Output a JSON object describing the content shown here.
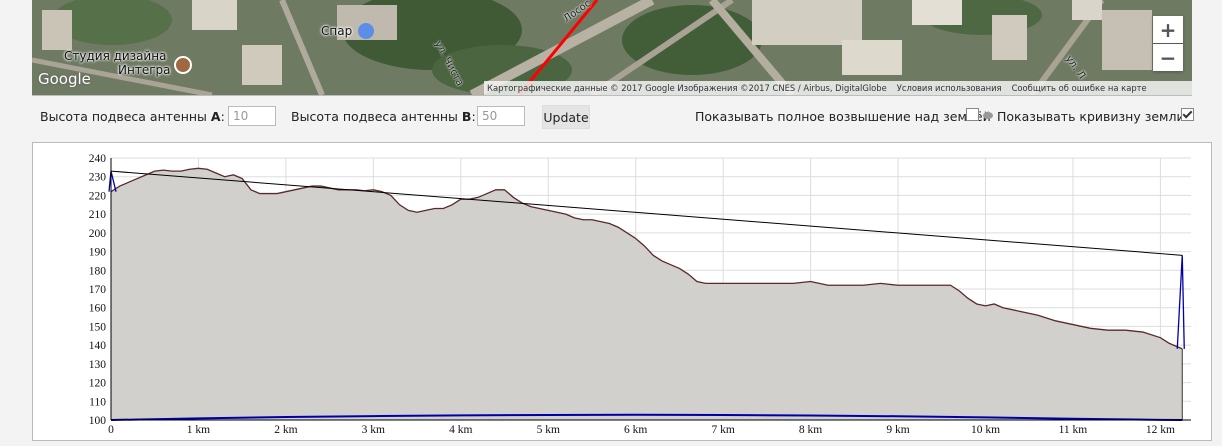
{
  "map": {
    "poi_studio": "Студия дизайна\nИнтегра",
    "poi_studio_line1": "Студия дизайна",
    "poi_studio_line2": "Интегра",
    "poi_spar": "Спар",
    "street_1": "Лосос",
    "street_2": "ул. Чиста",
    "street_3": "ул. Л",
    "google_logo": "Google",
    "attribution": "Картографические данные © 2017 Google Изображения ©2017 CNES / Airbus, DigitalGlobe",
    "terms": "Условия использования",
    "report": "Сообщить об ошибке на карте",
    "zoom_in": "+",
    "zoom_out": "−"
  },
  "controls": {
    "antenna_a_label": "Высота подвеса антенны ",
    "antenna_a_letter": "A",
    "antenna_a_value": "10",
    "antenna_b_label": "Высота подвеса антенны ",
    "antenna_b_letter": "B",
    "antenna_b_value": "50",
    "update_label": "Update",
    "show_full_elevation_label": "Показывать полное возвышение над землёй",
    "show_full_elevation_checked": false,
    "show_curvature_label": "Показывать кривизну земли",
    "show_curvature_checked": true
  },
  "chart_data": {
    "type": "area",
    "title": "",
    "xlabel": "",
    "ylabel": "",
    "xlim": [
      0,
      12.35
    ],
    "ylim": [
      100,
      240
    ],
    "grid": true,
    "y_ticks": [
      100,
      110,
      120,
      130,
      140,
      150,
      160,
      170,
      180,
      190,
      200,
      210,
      220,
      230,
      240
    ],
    "x_ticks": [
      0,
      1,
      2,
      3,
      4,
      5,
      6,
      7,
      8,
      9,
      10,
      11,
      12
    ],
    "x_tick_labels": [
      "0",
      "1 km",
      "2 km",
      "3 km",
      "4 km",
      "5 km",
      "6 km",
      "7 km",
      "8 km",
      "9 km",
      "10 km",
      "11 km",
      "12 km"
    ],
    "colors": {
      "terrain_fill": "#d1d0cc",
      "terrain_line": "#5a2a2a",
      "los_line": "#000000",
      "antenna": "#0000aa",
      "curvature": "#0000aa",
      "grid": "#dddddd"
    },
    "terrain": {
      "x": [
        0,
        0.1,
        0.2,
        0.3,
        0.4,
        0.5,
        0.6,
        0.7,
        0.8,
        0.9,
        1.0,
        1.1,
        1.2,
        1.3,
        1.4,
        1.5,
        1.6,
        1.7,
        1.8,
        1.9,
        2.0,
        2.1,
        2.2,
        2.3,
        2.4,
        2.5,
        2.6,
        2.7,
        2.8,
        2.9,
        3.0,
        3.1,
        3.2,
        3.3,
        3.4,
        3.5,
        3.6,
        3.7,
        3.8,
        3.9,
        4.0,
        4.1,
        4.2,
        4.3,
        4.4,
        4.5,
        4.6,
        4.7,
        4.8,
        4.9,
        5.0,
        5.1,
        5.2,
        5.3,
        5.4,
        5.5,
        5.6,
        5.7,
        5.8,
        5.9,
        6.0,
        6.1,
        6.2,
        6.3,
        6.4,
        6.5,
        6.6,
        6.7,
        6.8,
        7.0,
        7.2,
        7.4,
        7.6,
        7.8,
        8.0,
        8.1,
        8.2,
        8.3,
        8.4,
        8.6,
        8.8,
        9.0,
        9.2,
        9.4,
        9.6,
        9.7,
        9.8,
        9.9,
        10.0,
        10.1,
        10.2,
        10.4,
        10.6,
        10.8,
        11.0,
        11.2,
        11.4,
        11.6,
        11.8,
        12.0,
        12.1,
        12.2,
        12.25
      ],
      "y": [
        222,
        225,
        227,
        229,
        231,
        233,
        233.5,
        233,
        233,
        234,
        234.5,
        234,
        232,
        230,
        231,
        229,
        223,
        221,
        221,
        221,
        222,
        223,
        224,
        225,
        225,
        224,
        223,
        223,
        223,
        222.5,
        223,
        222,
        220,
        215,
        212,
        211,
        212,
        213,
        213,
        215,
        218,
        218,
        219,
        221,
        223,
        223,
        219,
        216,
        214,
        213,
        212,
        211,
        210,
        208,
        207,
        207,
        206,
        205,
        203,
        200,
        197,
        193,
        188,
        185,
        183,
        181,
        178,
        174,
        173,
        173,
        173,
        173,
        173,
        173,
        174,
        173,
        172,
        172,
        172,
        172,
        173,
        172,
        172,
        172,
        172,
        169,
        165,
        162,
        161,
        162,
        160,
        158,
        156,
        153,
        151,
        149,
        148,
        148,
        147,
        144,
        141,
        139,
        138
      ]
    },
    "line_of_sight": {
      "x": [
        0,
        12.25
      ],
      "y": [
        233,
        188
      ]
    },
    "antenna_a": {
      "x": 0,
      "ground": 222,
      "top": 233
    },
    "antenna_b": {
      "x": 12.25,
      "ground": 138,
      "top": 188
    },
    "curvature": {
      "x": [
        0,
        1,
        2,
        3,
        4,
        5,
        6,
        7,
        8,
        9,
        10,
        11,
        12,
        12.25
      ],
      "y": [
        100,
        100.9,
        101.6,
        102.1,
        102.5,
        102.7,
        102.8,
        102.7,
        102.4,
        102.0,
        101.4,
        100.7,
        100.1,
        100
      ]
    }
  }
}
